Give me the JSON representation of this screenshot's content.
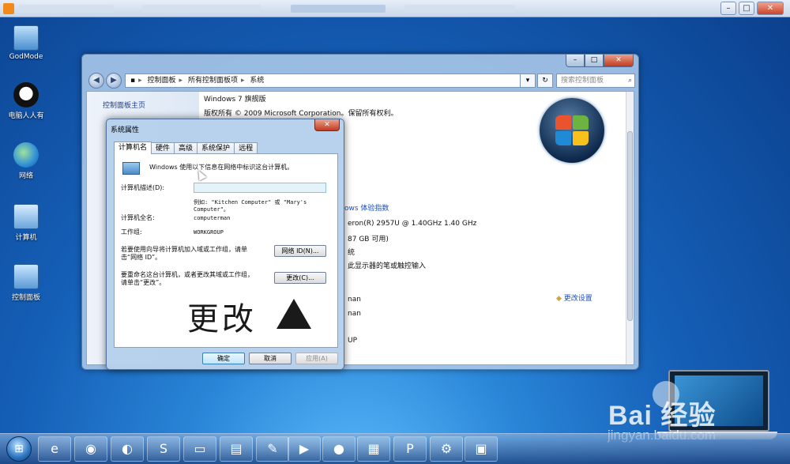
{
  "desktop": {
    "icons": [
      {
        "label": "GodMode"
      },
      {
        "label": "电脑人人有"
      },
      {
        "label": "网络"
      },
      {
        "label": "计算机"
      },
      {
        "label": "控制面板"
      }
    ]
  },
  "control_panel": {
    "breadcrumb": [
      "控制面板",
      "所有控制面板项",
      "系统"
    ],
    "search_placeholder": "搜索控制面板",
    "sidebar_home": "控制面板主页",
    "edition": "Windows 7 旗舰版",
    "copyright": "版权所有 © 2009 Microsoft Corporation。保留所有权利。",
    "experience_index": "ows 体验指数",
    "processor": "eron(R) 2957U @ 1.40GHz   1.40 GHz",
    "ram": "87 GB 可用)",
    "system_type": "统",
    "pen_touch": "此显示器的笔或触控输入",
    "name1": "nan",
    "name2": "nan",
    "workgroup_partial": "UP",
    "change_settings": "更改设置"
  },
  "dialog": {
    "title": "系统属性",
    "close_label": "✕",
    "tabs": [
      "计算机名",
      "硬件",
      "高级",
      "系统保护",
      "远程"
    ],
    "intro": "Windows 使用以下信息在网络中标识这台计算机。",
    "description_label": "计算机描述(D):",
    "example": "例如: \"Kitchen Computer\" 或 \"Mary's",
    "example2": "Computer\"。",
    "full_name_label": "计算机全名:",
    "full_name": "computerman",
    "workgroup_label": "工作组:",
    "workgroup": "WORKGROUP",
    "network_text1": "若要使用向导将计算机加入域或工作组，请单",
    "network_text2": "击“网络 ID”。",
    "network_button": "网络 ID(N)...",
    "rename_text1": "要重命名这台计算机，或者更改其域或工作组，",
    "rename_text2": "请单击“更改”。",
    "change_button": "更改(C)...",
    "annotation": "更改",
    "ok": "确定",
    "cancel": "取消",
    "apply": "应用(A)"
  },
  "watermark": {
    "logo": "Bai  经验",
    "url": "jingyan.baidu.com"
  }
}
